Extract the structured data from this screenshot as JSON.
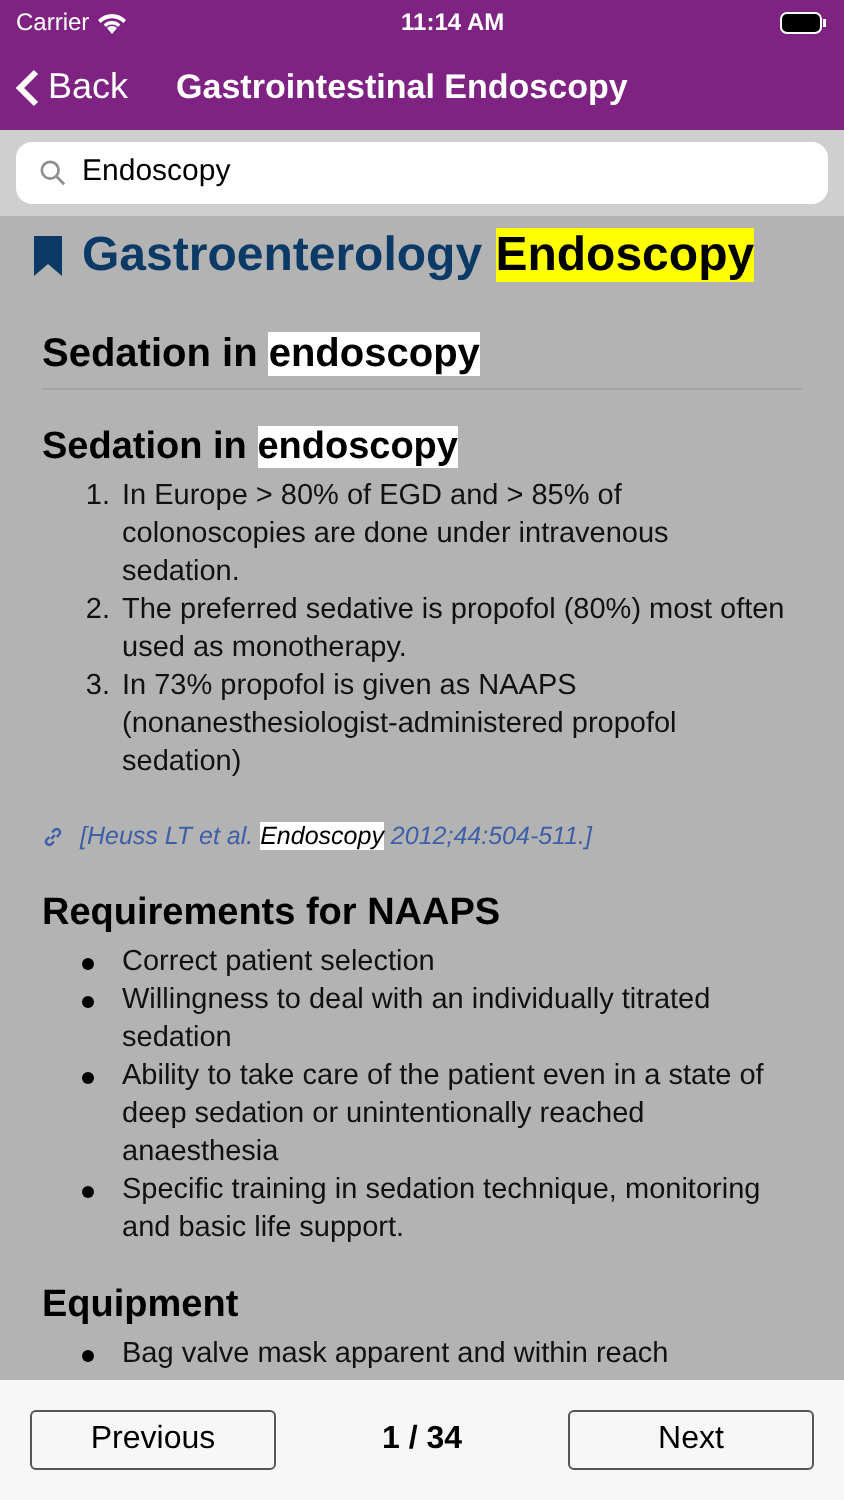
{
  "status_bar": {
    "carrier": "Carrier",
    "time": "11:14 AM"
  },
  "nav": {
    "back": "Back",
    "title": "Gastrointestinal Endoscopy"
  },
  "search": {
    "value": "Endoscopy"
  },
  "title": [
    {
      "text": "Gastroenterology ",
      "highlighted": false
    },
    {
      "text": "Endoscopy",
      "highlighted": true,
      "color": "#ffff00"
    }
  ],
  "section_heading": [
    {
      "text": "Sedation in ",
      "highlighted": false
    },
    {
      "text": "endoscopy",
      "highlighted": true,
      "color": "#ffffff"
    }
  ],
  "blocks": [
    {
      "kind": "heading",
      "segments": [
        {
          "text": "Sedation in ",
          "highlighted": false
        },
        {
          "text": "endoscopy",
          "highlighted": true,
          "color": "#ffffff"
        }
      ]
    },
    {
      "kind": "numbered",
      "items": [
        {
          "marker": "1.",
          "text": "In Europe > 80% of EGD and > 85% of colonoscopies are done under intravenous sedation."
        },
        {
          "marker": "2.",
          "text": "The preferred sedative is propofol (80%) most often used as monotherapy."
        },
        {
          "marker": "3.",
          "text": "In 73% propofol is given as NAAPS (nonanesthesiologist-administered propofol sedation)"
        }
      ]
    },
    {
      "kind": "citation",
      "segments": [
        {
          "text": "[Heuss LT et al. ",
          "highlighted": false
        },
        {
          "text": "Endoscopy",
          "highlighted": true,
          "color": "#ffffff"
        },
        {
          "text": " 2012;44:504-511.]",
          "highlighted": false
        }
      ]
    },
    {
      "kind": "heading",
      "segments": [
        {
          "text": "Requirements for NAAPS",
          "highlighted": false
        }
      ]
    },
    {
      "kind": "bulleted",
      "items": [
        {
          "text": "Correct patient selection"
        },
        {
          "text": "Willingness to deal with an individually titrated sedation"
        },
        {
          "text": "Ability to take care of the patient even in a state of deep sedation or unintentionally reached anaesthesia"
        },
        {
          "text": "Specific training in sedation technique, monitoring and basic life support."
        }
      ]
    },
    {
      "kind": "heading",
      "segments": [
        {
          "text": "Equipment",
          "highlighted": false
        }
      ]
    },
    {
      "kind": "bulleted",
      "items": [
        {
          "text": "Bag valve mask apparent and within reach"
        }
      ]
    }
  ],
  "footer": {
    "previous": "Previous",
    "page": "1 / 34",
    "next": "Next"
  }
}
